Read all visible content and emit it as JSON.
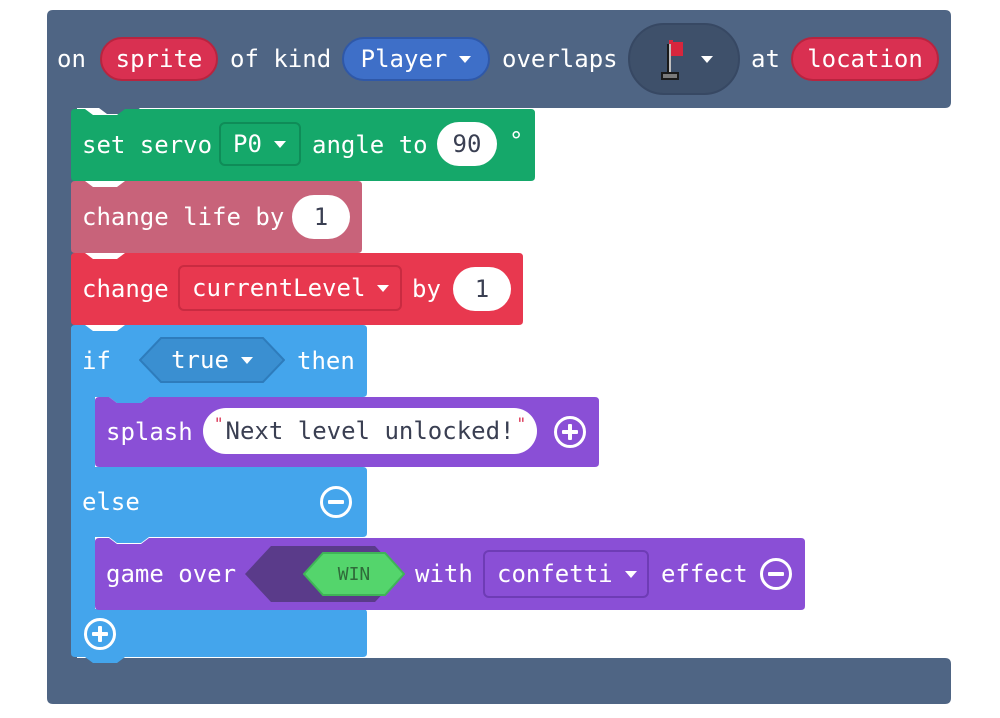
{
  "event": {
    "on_label": "on",
    "sprite_var": "sprite",
    "of_kind_label": "of kind",
    "kind_value": "Player",
    "overlaps_label": "overlaps",
    "tile_icon": "flag-tile-icon",
    "at_label": "at",
    "location_var": "location"
  },
  "servo": {
    "label": "set servo",
    "pin": "P0",
    "angle_label": "angle to",
    "angle_value": "90",
    "degree_symbol": "°"
  },
  "life": {
    "label": "change life by",
    "value": "1"
  },
  "level": {
    "label": "change",
    "variable": "currentLevel",
    "by_label": "by",
    "value": "1"
  },
  "if_block": {
    "if_label": "if",
    "condition": "true",
    "then_label": "then",
    "else_label": "else"
  },
  "splash": {
    "label": "splash",
    "text": "Next level unlocked!",
    "quote": "\""
  },
  "game_over": {
    "label": "game over",
    "result": "WIN",
    "with_label": "with",
    "effect_value": "confetti",
    "effect_label": "effect"
  },
  "colors": {
    "event": "#4f6584",
    "event_dark": "#3e506a",
    "variable_red": "#d93051",
    "kind_blue": "#3e6fc8",
    "servo": "#15a86a",
    "life": "#c8637a",
    "level": "#e8384f",
    "logic": "#44a5ec",
    "scene": "#8a4fd6",
    "win_green": "#54d56c"
  }
}
